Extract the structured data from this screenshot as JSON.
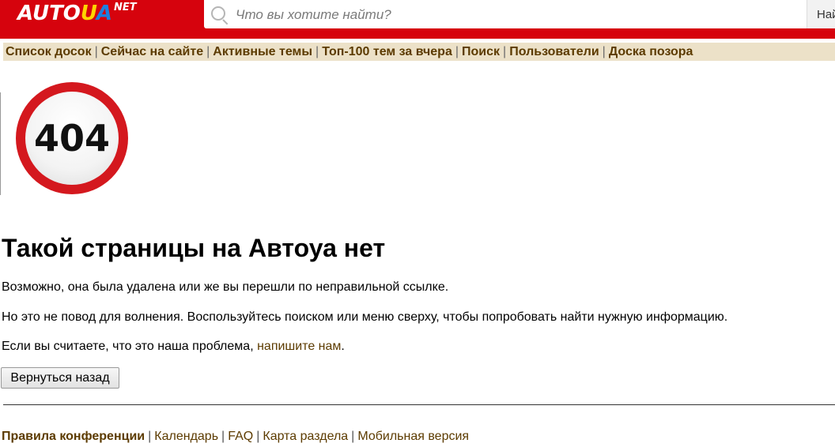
{
  "header": {
    "logo_auto": "AUTO",
    "logo_ua_u": "U",
    "logo_ua_a": "A",
    "logo_net": "NET",
    "search_placeholder": "Что вы хотите найти?",
    "search_button": "Найти",
    "brand_color": "#d6030d"
  },
  "nav": {
    "items": [
      "Список досок",
      "Сейчас на сайте",
      "Активные темы",
      "Топ-100 тем за вчера",
      "Поиск",
      "Пользователи",
      "Доска позора"
    ],
    "separator": "|"
  },
  "error": {
    "code": "404",
    "title": "Такой страницы на Автоуа нет",
    "line1": "Возможно, она была удалена или же вы перешли по неправильной ссылке.",
    "line2": "Но это не повод для волнения. Воспользуйтесь поиском или меню сверху, чтобы попробовать найти нужную информацию.",
    "line3_prefix": "Если вы считаете, что это наша проблема, ",
    "line3_link": "напишите нам",
    "line3_suffix": ".",
    "back_button": "Вернуться назад"
  },
  "footer": {
    "items": [
      "Правила конференции",
      "Календарь",
      "FAQ",
      "Карта раздела",
      "Мобильная версия"
    ],
    "separator": "|"
  }
}
